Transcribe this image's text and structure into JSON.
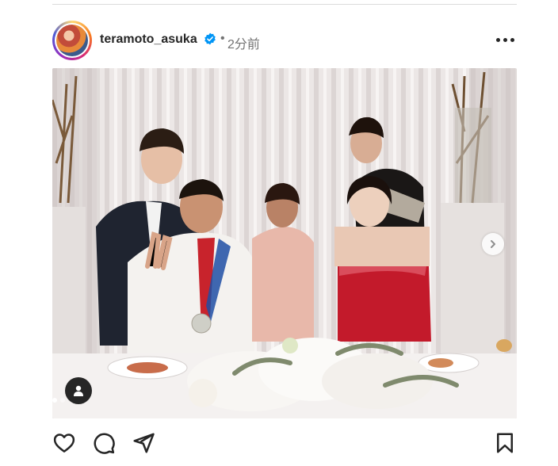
{
  "post": {
    "username": "teramoto_asuka",
    "separator": "•",
    "time": "2分前",
    "verified": true,
    "carousel": {
      "current_index": 1,
      "total": 2
    }
  },
  "icons": {
    "more": "more-horizontal-icon",
    "verified": "verified-badge-icon",
    "next": "chevron-right-icon",
    "tag": "user-tag-icon",
    "like": "heart-icon",
    "comment": "comment-icon",
    "share": "paper-plane-icon",
    "save": "bookmark-icon"
  },
  "colors": {
    "text": "#262626",
    "muted": "#737373",
    "verified": "#0095f6",
    "active_dot": "#ffffff"
  }
}
